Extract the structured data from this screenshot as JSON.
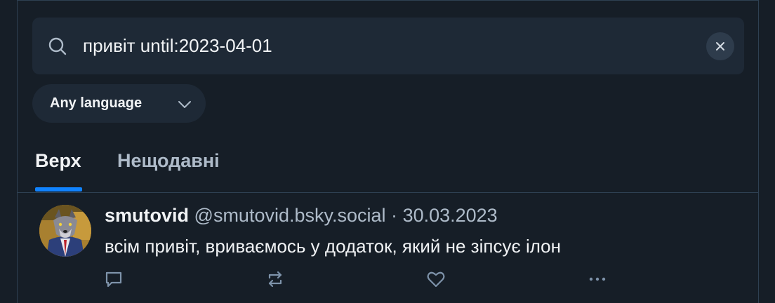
{
  "search": {
    "query": "привіт until:2023-04-01",
    "icon": "search-icon",
    "clear_icon": "close-icon"
  },
  "filter": {
    "language_selected": "Any language",
    "chevron_icon": "chevron-down-icon"
  },
  "tabs": [
    {
      "label": "Верх",
      "active": true
    },
    {
      "label": "Нещодавні",
      "active": false
    }
  ],
  "post": {
    "author_name": "smutovid",
    "author_handle": "@smutovid.bsky.social",
    "separator": "·",
    "date": "30.03.2023",
    "text": "всім привіт, вриваємось у додаток, який не зіпсує ілон",
    "actions": [
      "reply-icon",
      "repost-icon",
      "like-icon",
      "more-icon"
    ]
  },
  "colors": {
    "background": "#161e27",
    "surface": "#1e2936",
    "accent": "#1083fe",
    "text_primary": "#f1f3f5",
    "text_secondary": "#aebbc9",
    "border": "#2e4052"
  }
}
